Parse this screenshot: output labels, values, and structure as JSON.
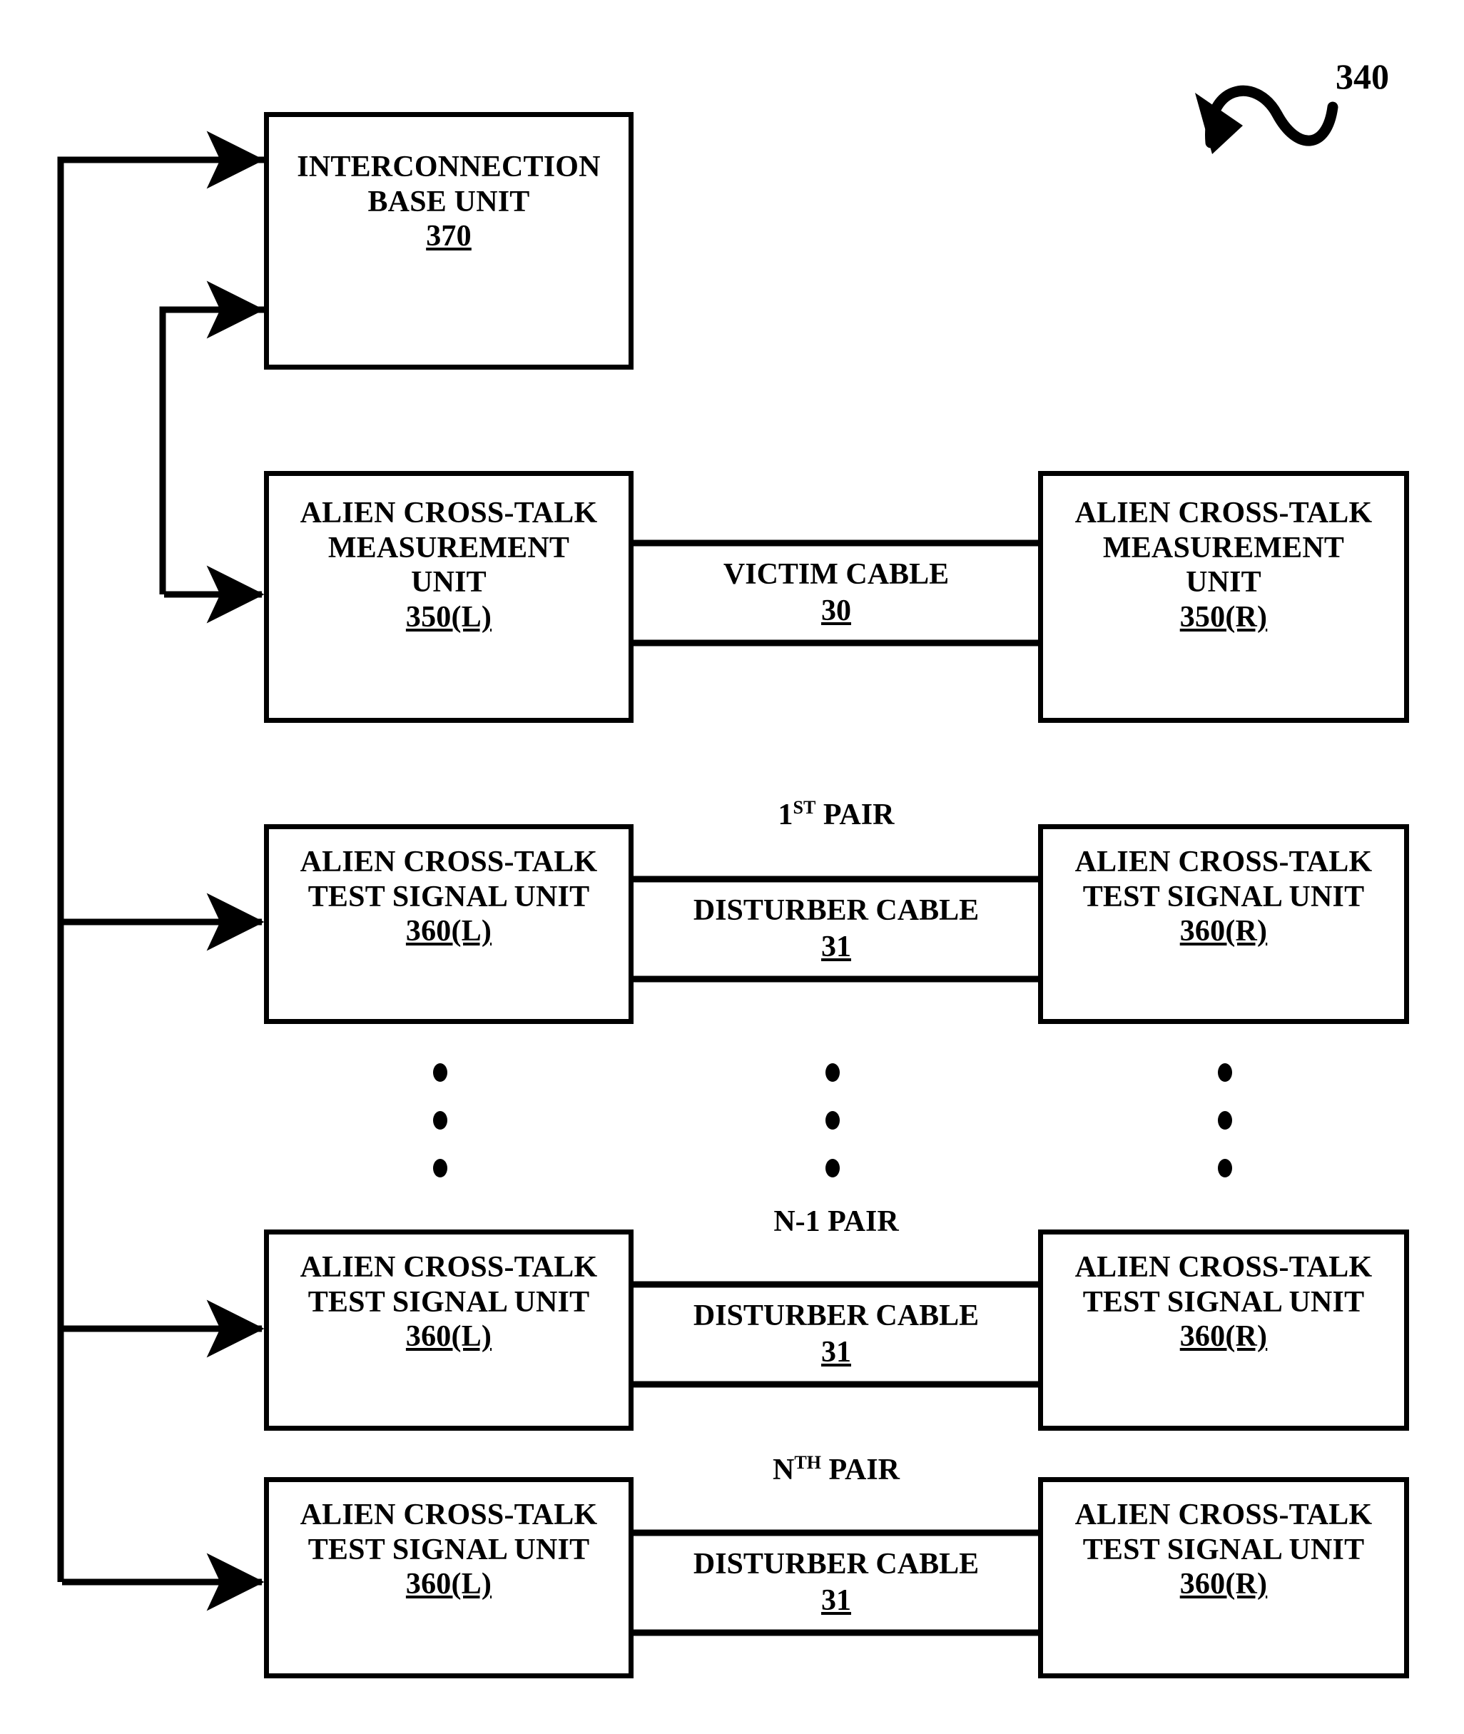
{
  "figure": {
    "number": "340",
    "callout_icon": "squiggle-arrow-icon"
  },
  "boxes": {
    "interconnection_base": {
      "line1": "INTERCONNECTION",
      "line2": "BASE UNIT",
      "ref": "370"
    },
    "measurement_left": {
      "line1": "ALIEN CROSS-TALK",
      "line2": "MEASUREMENT",
      "line3": "UNIT",
      "ref": "350(L)"
    },
    "measurement_right": {
      "line1": "ALIEN CROSS-TALK",
      "line2": "MEASUREMENT",
      "line3": "UNIT",
      "ref": "350(R)"
    },
    "test_signal_left": {
      "line1": "ALIEN CROSS-TALK",
      "line2": "TEST SIGNAL UNIT",
      "ref": "360(L)"
    },
    "test_signal_right": {
      "line1": "ALIEN CROSS-TALK",
      "line2": "TEST SIGNAL UNIT",
      "ref": "360(R)"
    }
  },
  "cables": {
    "victim": {
      "label": "VICTIM CABLE",
      "ref": "30"
    },
    "disturber": {
      "label": "DISTURBER CABLE",
      "ref": "31"
    }
  },
  "pair_labels": {
    "first": {
      "base": "1",
      "sup": "ST",
      "suffix": " PAIR"
    },
    "n_minus_1": {
      "base": "N-1",
      "sup": "",
      "suffix": " PAIR"
    },
    "nth": {
      "base": "N",
      "sup": "TH",
      "suffix": " PAIR"
    }
  },
  "ellipsis": {
    "glyph": "vertical-ellipsis-dots",
    "count": 3
  },
  "colors": {
    "stroke": "#000000",
    "background": "#ffffff"
  }
}
